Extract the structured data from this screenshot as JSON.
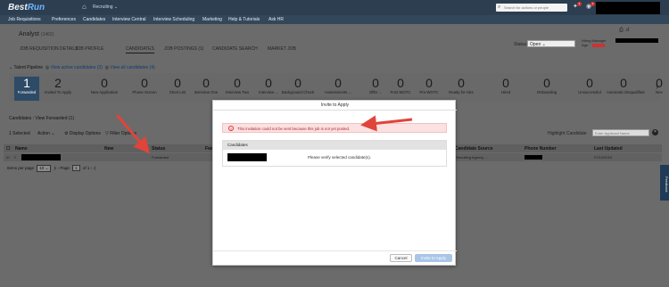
{
  "shell": {
    "logo_main": "Best",
    "logo_accent": "Run",
    "module": "Recruiting",
    "search_placeholder": "Search for actions or people",
    "notif_count_1": "1",
    "notif_count_2": "1"
  },
  "nav": [
    "Job Requisitions",
    "Preferences",
    "Candidates",
    "Interview Central",
    "Interview Scheduling",
    "Marketing",
    "Help & Tutorials",
    "Ask HR"
  ],
  "requisition": {
    "title": "Analyst",
    "count": "(1462)"
  },
  "tabs": [
    "JOB REQUISITION DETAILS",
    "JOB PROFILE",
    "CANDIDATES",
    "JOB POSTINGS (1)",
    "CANDIDATE SEARCH",
    "MARKET JOB"
  ],
  "status": {
    "label": "Status",
    "value": "Open"
  },
  "hiring_manager": {
    "label": "Hiring Manager",
    "age_label": "Age"
  },
  "talent_pipeline": {
    "label": "Talent Pipeline",
    "view_active": "View active candidates (3)",
    "view_all": "View all candidates (4)",
    "stages": [
      {
        "num": "1",
        "name": "Forwarded"
      },
      {
        "num": "2",
        "name": "Invited To Apply"
      },
      {
        "num": "0",
        "name": "New Application"
      },
      {
        "num": "0",
        "name": "Phone Screen"
      },
      {
        "num": "0",
        "name": "Short List"
      },
      {
        "num": "0",
        "name": "Interview One"
      },
      {
        "num": "0",
        "name": "Interview Two"
      },
      {
        "num": "0",
        "name": "Interview ..."
      },
      {
        "num": "0",
        "name": "Background Check"
      },
      {
        "num": "0",
        "name": "Assessments ..."
      },
      {
        "num": "0",
        "name": "Offer ..."
      },
      {
        "num": "0",
        "name": "Post WOTC"
      },
      {
        "num": "0",
        "name": "Pre-WOTC"
      },
      {
        "num": "0",
        "name": "Ready for Hire"
      },
      {
        "num": "0",
        "name": "Hired"
      },
      {
        "num": "0",
        "name": "Onboarding"
      },
      {
        "num": "0",
        "name": "Unsuccessful"
      },
      {
        "num": "0",
        "name": "Automatic Disqualified"
      },
      {
        "num": "0",
        "name": "Nev"
      }
    ]
  },
  "candidates_header": "Candidates : View Forwarded (1)",
  "toolbar": {
    "selected": "1 Selected",
    "action": "Action",
    "display": "Display Options",
    "filter": "Filter Options",
    "highlight_label": "Highlight Candidate",
    "highlight_placeholder": "Enter Applicant Name"
  },
  "table": {
    "headers": [
      "Name",
      "New",
      "Status",
      "Fwd",
      "Candidate Source",
      "Phone Number",
      "Last Updated"
    ],
    "row": {
      "status": "Forwarded",
      "source": "Recruiting Agency ...",
      "updated": "07/12/2019"
    }
  },
  "pager": {
    "label": "Items per page",
    "per_page": "10",
    "page_label": "Page",
    "page": "1",
    "of": "of 1"
  },
  "feedback": "Feedback",
  "modal": {
    "title": "Invite to Apply",
    "error": "This invitation could not be sent because this job is not yet posted.",
    "col_header": "Candidates",
    "verify": "Please verify selected candidate(s).",
    "cancel": "Cancel",
    "invite": "Invite to Apply"
  },
  "colors": {
    "topbar": "#2c3e50",
    "accent": "#6fb5ff",
    "error": "#b1252c",
    "arrow": "#e0443a"
  }
}
